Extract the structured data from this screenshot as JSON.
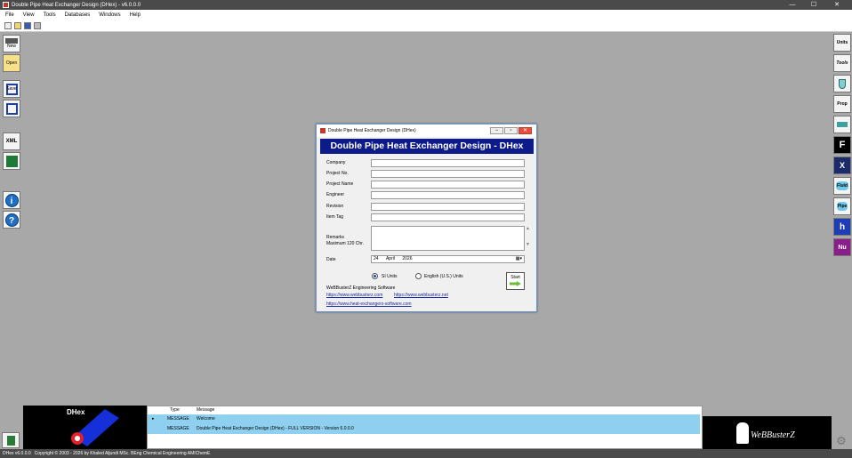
{
  "window": {
    "title": "Double Pipe Heat Exchanger Design (DHex) - v6.0.0.0",
    "min": "—",
    "max": "☐",
    "close": "✕"
  },
  "menu": [
    "File",
    "View",
    "Tools",
    "Databases",
    "Windows",
    "Help"
  ],
  "left_buttons": [
    {
      "label": "New",
      "icon": "new-icon"
    },
    {
      "label": "Open",
      "icon": "open-icon"
    },
    {
      "label": "Save",
      "icon": "save-icon"
    },
    {
      "label": "",
      "icon": "save-as-icon"
    },
    {
      "label": "XML",
      "icon": "xml-icon"
    },
    {
      "label": "",
      "icon": "excel-icon"
    },
    {
      "label": "i",
      "icon": "info-icon"
    },
    {
      "label": "?",
      "icon": "help-icon"
    }
  ],
  "right_buttons": [
    {
      "label": "Units",
      "icon": "units-icon"
    },
    {
      "label": "Tools",
      "icon": "tools-icon"
    },
    {
      "label": "",
      "icon": "flask-icon"
    },
    {
      "label": "Prop",
      "icon": "properties-icon"
    },
    {
      "label": "",
      "icon": "pipe-icon"
    },
    {
      "label": "F",
      "icon": "f-factor-icon"
    },
    {
      "label": "X",
      "icon": "exchanger-icon"
    },
    {
      "label": "Fluid",
      "icon": "fluid-icon"
    },
    {
      "label": "Pipe",
      "icon": "pipe-db-icon"
    },
    {
      "label": "h",
      "icon": "h-coefficient-icon"
    },
    {
      "label": "Nu",
      "icon": "nusselt-icon"
    }
  ],
  "dialog": {
    "title": "Double Pipe Heat Exchanger Design (DHex)",
    "banner": "Double Pipe Heat Exchanger Design - DHex",
    "fields": [
      {
        "label": "Company",
        "value": ""
      },
      {
        "label": "Project No.",
        "value": ""
      },
      {
        "label": "Project Name",
        "value": ""
      },
      {
        "label": "Engineer",
        "value": ""
      },
      {
        "label": "Revision",
        "value": ""
      },
      {
        "label": "Item Tag",
        "value": ""
      }
    ],
    "remarks_label": "Remarks",
    "remarks_hint": "Maximum 120 Chr.",
    "date_label": "Date",
    "date": {
      "day": "24",
      "month": "April",
      "year": "2026"
    },
    "units": {
      "si": "SI Units",
      "english": "English (U.S.) Units",
      "selected": "si"
    },
    "company_name": "WeBBusterZ Engineering Software",
    "links": [
      "https://www.webbusterz.com",
      "https://www.webbusterz.net",
      "https://www.heat-exchangers-software.com"
    ],
    "start_label": "Start"
  },
  "messages": {
    "headers": [
      "Type",
      "Message"
    ],
    "rows": [
      {
        "type": "MESSAGE",
        "message": "Welcome"
      },
      {
        "type": "MESSAGE",
        "message": "Double Pipe Heat Exchanger Design (DHex) - FULL VERSION - Version 6.0.0.0"
      }
    ]
  },
  "logo_left": {
    "text": "DHex"
  },
  "logo_right": {
    "text": "WeBBusterZ"
  },
  "status": {
    "version": "DHex v6.0.0.0",
    "copyright": "Copyright © 2003 - 2026 by Khaled Aljundi MSc. BEng Chemical Engineering AMIChemE"
  },
  "colors": {
    "banner": "#0d1a8a",
    "msg_selected": "#8fd0f0",
    "status_bg": "#4a4a4a"
  }
}
